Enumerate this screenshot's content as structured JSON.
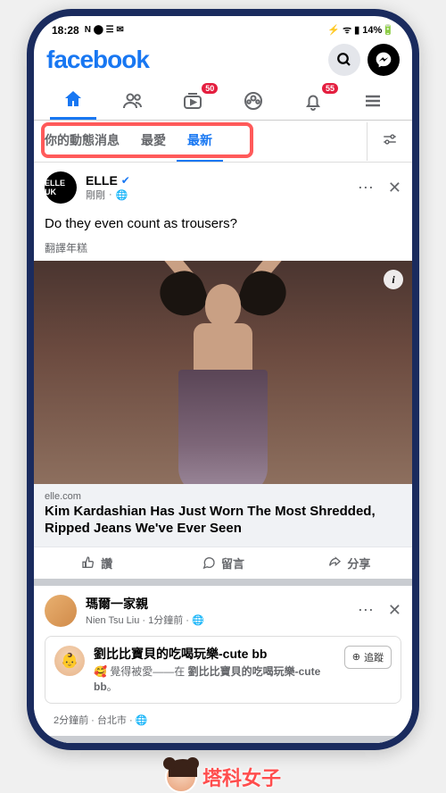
{
  "status_bar": {
    "time": "18:28",
    "indicators": "N ⬤ ☰ ✉",
    "right": "⚡ ᯤ ▮ 14%🔋"
  },
  "header": {
    "logo": "facebook"
  },
  "main_tabs": {
    "watch_badge": "50",
    "notif_badge": "55"
  },
  "feed_tabs": {
    "items": [
      {
        "label": "你的動態消息",
        "active": false
      },
      {
        "label": "最愛",
        "active": false
      },
      {
        "label": "最新",
        "active": true
      }
    ]
  },
  "post1": {
    "avatar_text": "ELLE UK",
    "author": "ELLE",
    "time": "剛剛",
    "privacy": "🌐",
    "text": "Do they even count as trousers?",
    "translate": "翻譯年糕",
    "info": "i",
    "link_domain": "elle.com",
    "link_title": "Kim Kardashian Has Just Worn The Most Shredded, Ripped Jeans We've Ever Seen",
    "like": "讚",
    "comment": "留言",
    "share": "分享"
  },
  "post2": {
    "author": "瑪爾一家親",
    "meta": "Nien Tsu Liu · 1分鐘前 · 🌐",
    "shared_title": "劉比比寶貝的吃喝玩樂-cute bb",
    "shared_sub_prefix": "🥰 覺得被愛——在 ",
    "shared_sub_link": "劉比比寶貝的吃喝玩樂-cute bb",
    "shared_sub_suffix": "。",
    "follow": "追蹤",
    "shared_meta": "2分鐘前 · 台北市 · 🌐"
  },
  "watermark": "塔科女子"
}
